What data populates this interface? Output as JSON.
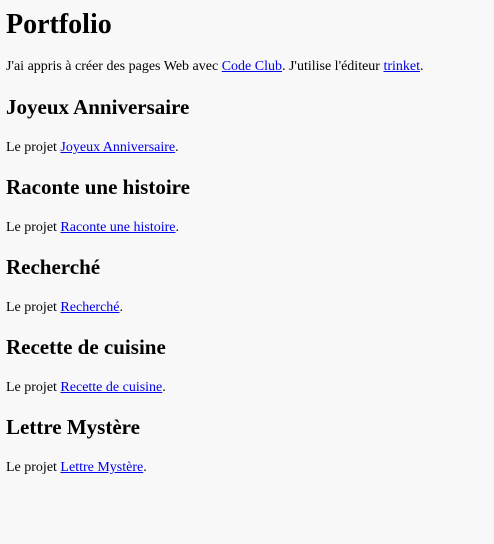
{
  "page": {
    "title": "Portfolio",
    "intro": {
      "prefix": "J'ai appris à créer des pages Web avec ",
      "link1": "Code Club",
      "middle": ". J'utilise l'éditeur ",
      "link2": "trinket",
      "suffix": "."
    },
    "project_prefix": "Le projet ",
    "project_suffix": ".",
    "projects": [
      {
        "heading": "Joyeux Anniversaire",
        "link": "Joyeux Anniversaire"
      },
      {
        "heading": "Raconte une histoire",
        "link": "Raconte une histoire"
      },
      {
        "heading": "Recherché",
        "link": "Recherché"
      },
      {
        "heading": "Recette de cuisine",
        "link": "Recette de cuisine"
      },
      {
        "heading": "Lettre Mystère",
        "link": "Lettre Mystère"
      }
    ]
  },
  "colors": {
    "background": "#f8f8f8",
    "link": "#0000ee",
    "text": "#000000"
  }
}
